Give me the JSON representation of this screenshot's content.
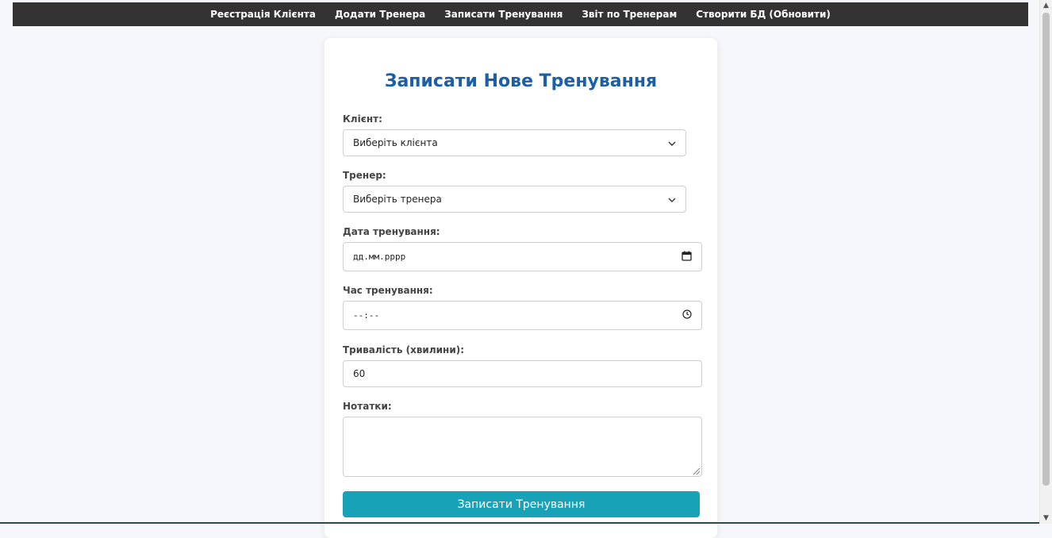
{
  "nav": {
    "items": [
      {
        "label": "Реєстрація Клієнта"
      },
      {
        "label": "Додати Тренера"
      },
      {
        "label": "Записати Тренування"
      },
      {
        "label": "Звіт по Тренерам"
      },
      {
        "label": "Створити БД (Обновити)"
      }
    ]
  },
  "form": {
    "title": "Записати Нове Тренування",
    "client": {
      "label": "Клієнт:",
      "value": "Виберіть клієнта"
    },
    "trainer": {
      "label": "Тренер:",
      "value": "Виберіть тренера"
    },
    "date": {
      "label": "Дата тренування:",
      "value": "дд.мм.рррр"
    },
    "time": {
      "label": "Час тренування:",
      "value": "--:--"
    },
    "duration": {
      "label": "Тривалість (хвилини):",
      "value": "60"
    },
    "notes": {
      "label": "Нотатки:",
      "value": ""
    },
    "submit_label": "Записати Тренування"
  },
  "icons": {
    "select": "chevron-down-icon",
    "date": "calendar-icon",
    "time": "clock-icon"
  },
  "colors": {
    "nav_bg": "#333333",
    "title": "#1a5fa8",
    "button": "#17a2b8"
  }
}
